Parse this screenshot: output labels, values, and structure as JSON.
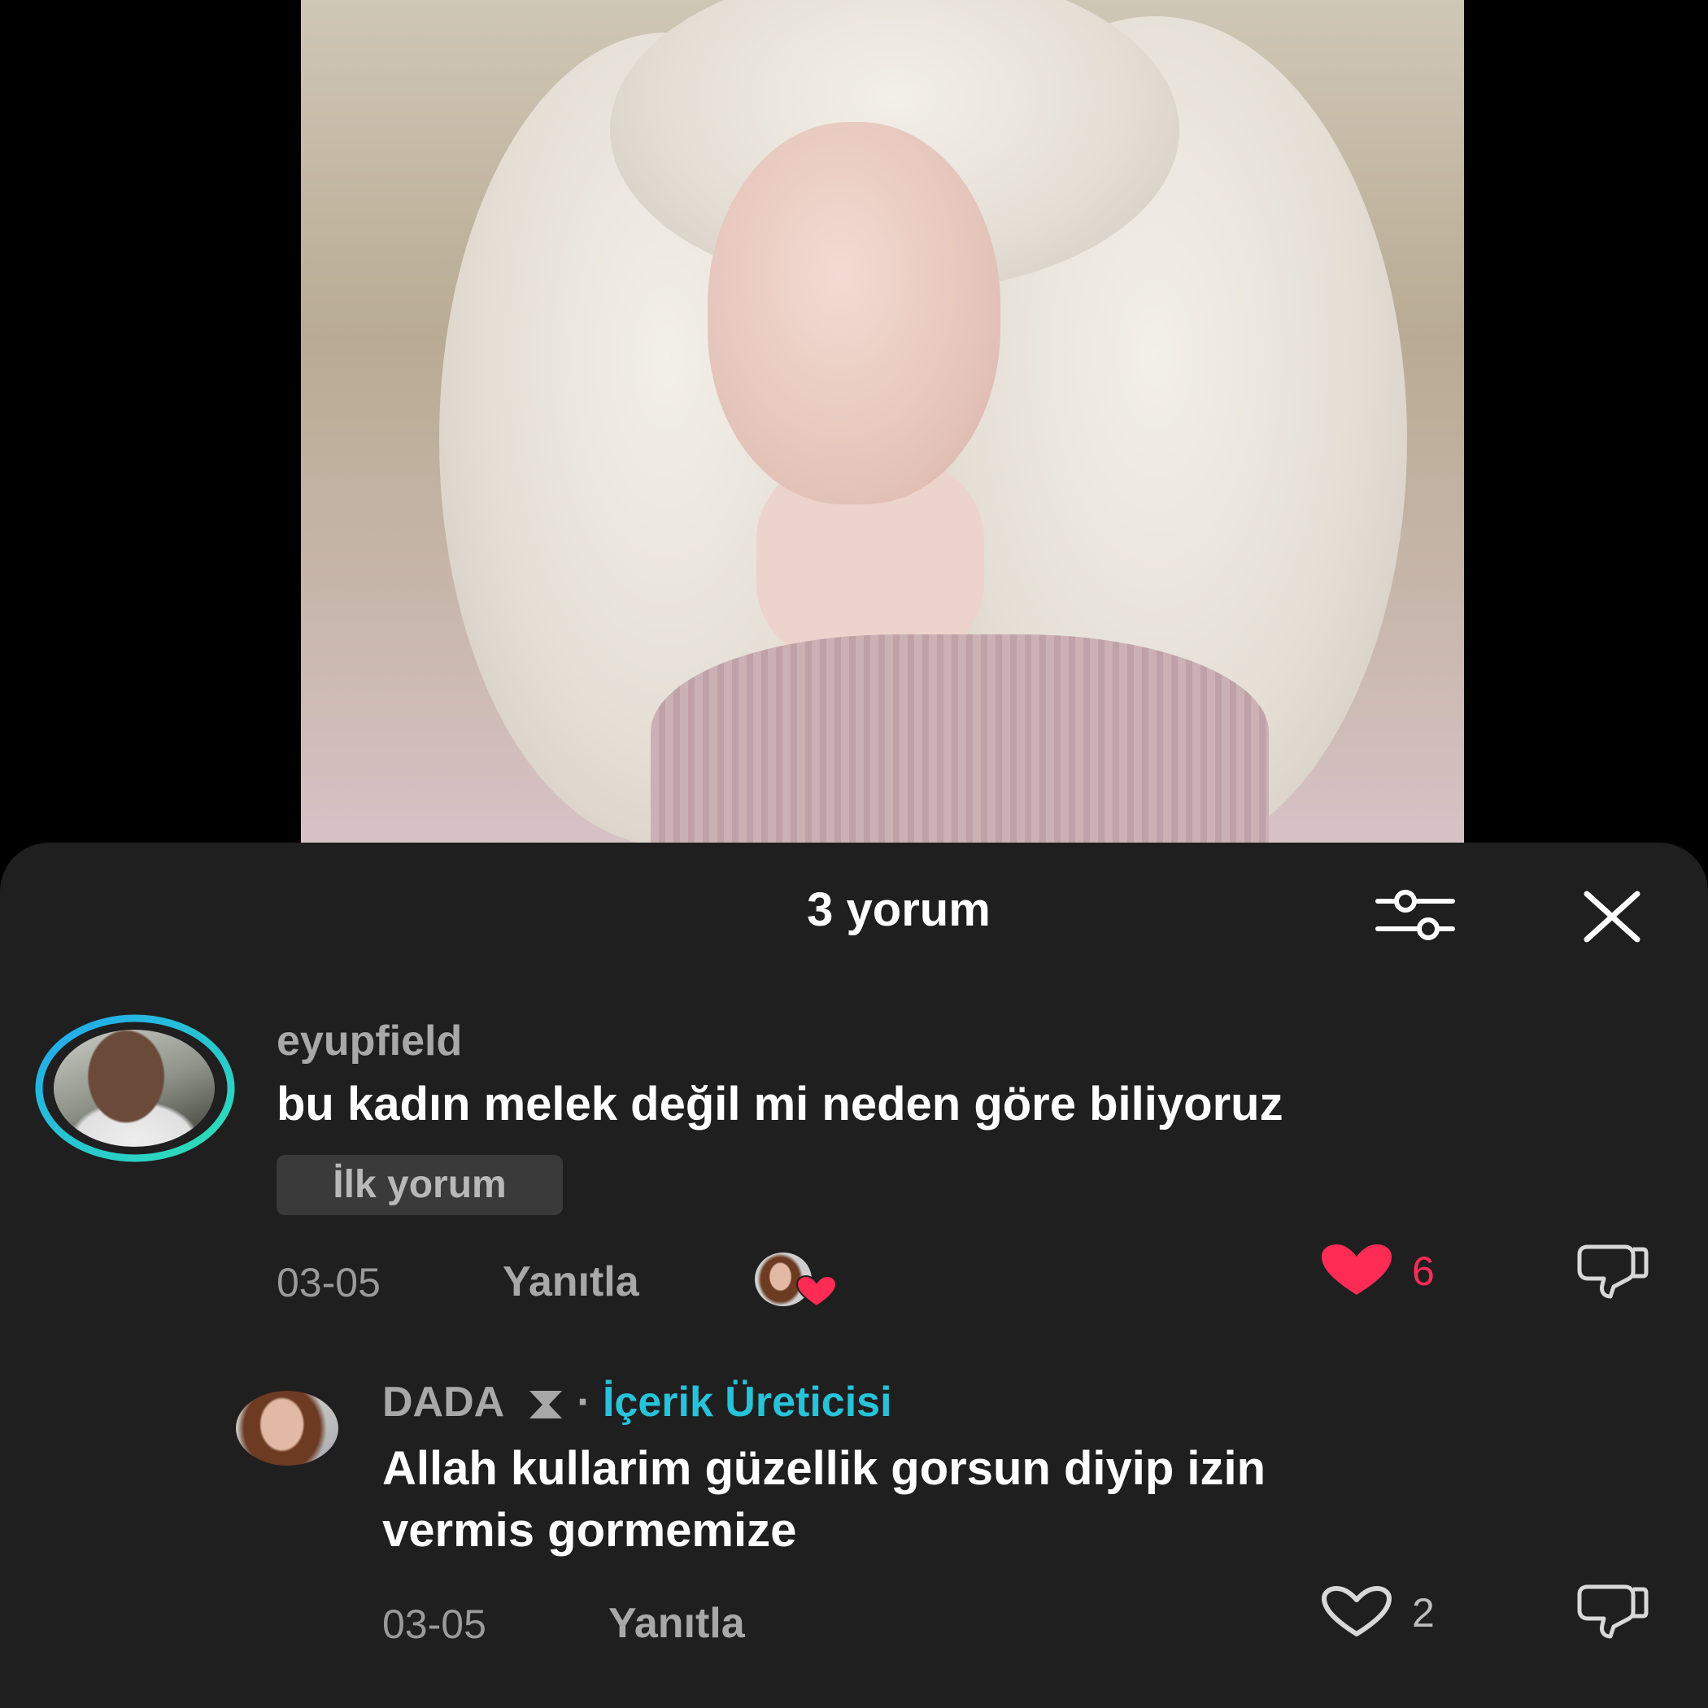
{
  "colors": {
    "sheet_bg": "#1f1f1f",
    "accent_cyan": "#27c3d9",
    "liked_red": "#fe2c55",
    "muted_text": "#a8a8a8"
  },
  "sheet": {
    "title": "3 yorum",
    "filter_icon": "sliders-icon",
    "close_icon": "close-icon"
  },
  "comments": [
    {
      "username": "eyupfield",
      "text": "bu kadın melek değil mi neden göre biliyoruz",
      "badge": "İlk yorum",
      "date": "03-05",
      "reply_label": "Yanıtla",
      "likes": "6",
      "liked": true,
      "creator_liked": true
    },
    {
      "username": "DADA",
      "username_suffix_icon": "hourglass-icon",
      "separator": "·",
      "role": "İçerik Üreticisi",
      "text_line1": "Allah kullarim güzellik gorsun diyip izin",
      "text_line2": "vermis gormemize",
      "date": "03-05",
      "reply_label": "Yanıtla",
      "likes": "2",
      "liked": false
    }
  ]
}
